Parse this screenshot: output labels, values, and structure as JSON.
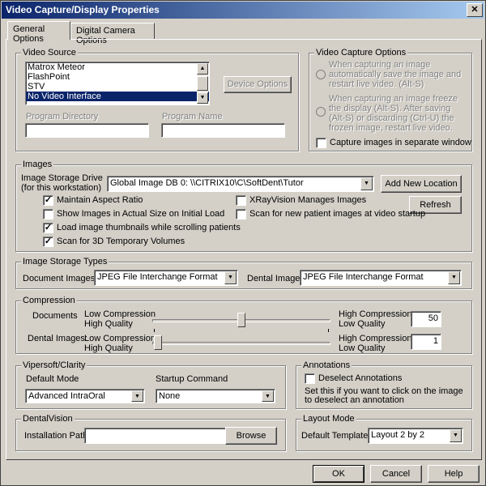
{
  "window": {
    "title": "Video Capture/Display Properties",
    "close_glyph": "✕"
  },
  "tabs": [
    {
      "label": "General Options",
      "active": true
    },
    {
      "label": "Digital Camera Options",
      "active": false
    }
  ],
  "video_source": {
    "title": "Video Source",
    "items": [
      "Matrox Meteor",
      "FlashPoint",
      "STV",
      "No Video Interface"
    ],
    "selected_index": 3,
    "device_options_label": "Device Options",
    "program_directory_label": "Program Directory",
    "program_directory_value": "",
    "program_name_label": "Program Name",
    "program_name_value": ""
  },
  "video_capture_options": {
    "title": "Video Capture Options",
    "radio1_label": "When capturing an image automatically save the image and restart live video. (Alt-S)",
    "radio2_label": "When capturing an image freeze the display (Alt-S). After saving (Alt-S) or discarding (Ctrl-U) the frozen image, restart live video.",
    "separate_window_label": "Capture images in separate window",
    "separate_window_checked": false
  },
  "images": {
    "title": "Images",
    "storage_drive_label": "Image Storage Drive (for this workstation)",
    "storage_drive_value": "Global Image DB 0: \\\\CITRIX10\\C\\SoftDent\\Tutor",
    "add_location_label": "Add New Location",
    "refresh_label": "Refresh",
    "options": [
      {
        "label": "Maintain Aspect Ratio",
        "checked": true
      },
      {
        "label": "Show Images in Actual Size on Initial Load",
        "checked": false
      },
      {
        "label": "Load image thumbnails while scrolling patients",
        "checked": true
      },
      {
        "label": "Scan for 3D Temporary Volumes",
        "checked": true
      },
      {
        "label": "XRayVision Manages Images",
        "checked": false
      },
      {
        "label": "Scan for new patient images at video startup",
        "checked": false
      }
    ]
  },
  "storage_types": {
    "title": "Image Storage Types",
    "document_label": "Document Images",
    "document_value": "JPEG File Interchange Format",
    "dental_label": "Dental Images",
    "dental_value": "JPEG File Interchange Format"
  },
  "compression": {
    "title": "Compression",
    "documents_label": "Documents",
    "dental_label": "Dental Images:",
    "low_compression": "Low Compression",
    "high_quality": "High Quality",
    "high_compression": "High Compression",
    "low_quality": "Low Quality",
    "documents_value": "50",
    "dental_value": "1",
    "documents_slider_fraction": 0.5,
    "dental_slider_fraction": 0.01
  },
  "vipersoft": {
    "title": "Vipersoft/Clarity",
    "default_mode_label": "Default Mode",
    "default_mode_value": "Advanced IntraOral",
    "startup_label": "Startup Command",
    "startup_value": "None"
  },
  "annotations": {
    "title": "Annotations",
    "deselect_label": "Deselect Annotations",
    "deselect_checked": false,
    "hint": "Set this if you want to click on the image to deselect an annotation"
  },
  "dentalvision": {
    "title": "DentalVision",
    "install_path_label": "Installation Path",
    "install_path_value": "",
    "browse_label": "Browse"
  },
  "layout_mode": {
    "title": "Layout Mode",
    "default_template_label": "Default Template",
    "default_template_value": "Layout 2 by 2"
  },
  "footer": {
    "ok_label": "OK",
    "cancel_label": "Cancel",
    "help_label": "Help"
  },
  "glyphs": {
    "check": "✓",
    "arrow_down": "▼",
    "arrow_up": "▲"
  }
}
